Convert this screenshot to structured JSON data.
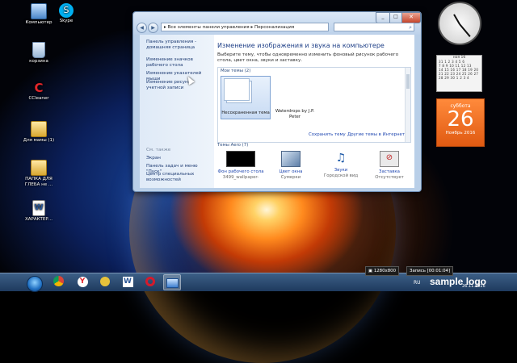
{
  "desktop": {
    "icons": [
      {
        "label": "Компьютер",
        "icon": "computer-icon"
      },
      {
        "label": "Skype",
        "icon": "skype-icon"
      },
      {
        "label": "корзина",
        "icon": "recycle-bin-icon"
      },
      {
        "label": "CCleaner",
        "icon": "ccleaner-icon"
      },
      {
        "label": "Для мамы (1)",
        "icon": "folder-icon"
      },
      {
        "label": "ПАПКА ДЛЯ ГЛЕБА не ...",
        "icon": "folder-icon"
      },
      {
        "label": "ХАРАКТЕР...",
        "icon": "word-document-icon"
      }
    ]
  },
  "window": {
    "address": "▸ Все элементы панели управления ▸ Персонализация",
    "sidebar": {
      "home_link": "Панель управления - домашняя страница",
      "links": [
        "Изменение значков рабочего стола",
        "Изменение указателей мыши",
        "Изменение рисунка учетной записи"
      ],
      "see_also_header": "См. также",
      "see_also": [
        "Экран",
        "Панель задач и меню \"Пуск\"",
        "Центр специальных возможностей"
      ]
    },
    "main": {
      "title": "Изменение изображения и звука на компьютере",
      "description": "Выберите тему, чтобы одновременно изменить фоновый рисунок рабочего стола, цвет окна, звуки и заставку.",
      "my_themes_label": "Мои темы (2)",
      "themes": [
        {
          "caption": "Несохраненная тема"
        },
        {
          "caption": "Waterdrops by J.P. Peter"
        }
      ],
      "save_theme_link": "Сохранить тему",
      "other_themes_link": "Другие темы в Интернете",
      "aero_label": "Темы Aero (7)",
      "bottom_items": [
        {
          "title": "Фон рабочего стола",
          "sub": "3499_wallpaper-",
          "icon": "wallpaper-icon"
        },
        {
          "title": "Цвет окна",
          "sub": "Сумерки",
          "icon": "window-color-icon"
        },
        {
          "title": "Звуки",
          "sub": "Городской вид",
          "icon": "sounds-icon"
        },
        {
          "title": "Заставка",
          "sub": "Отсутствует",
          "icon": "screensaver-icon"
        }
      ]
    }
  },
  "gadgets": {
    "calendar_month": "ноя 16",
    "calendar_grid": [
      "31  1  2  3  4  5  6",
      " 7  8  9 10 11 12 13",
      "14 15 16 17 18 19 20",
      "21 22 23 24 25 26 27",
      "28 29 30  1  2  3  4"
    ],
    "big_day_of_week": "суббота",
    "big_day": "26",
    "big_month_year": "Ноябрь 2016"
  },
  "taskbar": {
    "resolution": "1280x800",
    "recording": "Запись [00:01:04]",
    "language": "RU",
    "logo": "sample logo",
    "date": "26.11.2016",
    "apps": [
      "windows-explorer",
      "chrome",
      "yandex",
      "gadget",
      "word",
      "opera",
      "control-panel"
    ]
  }
}
